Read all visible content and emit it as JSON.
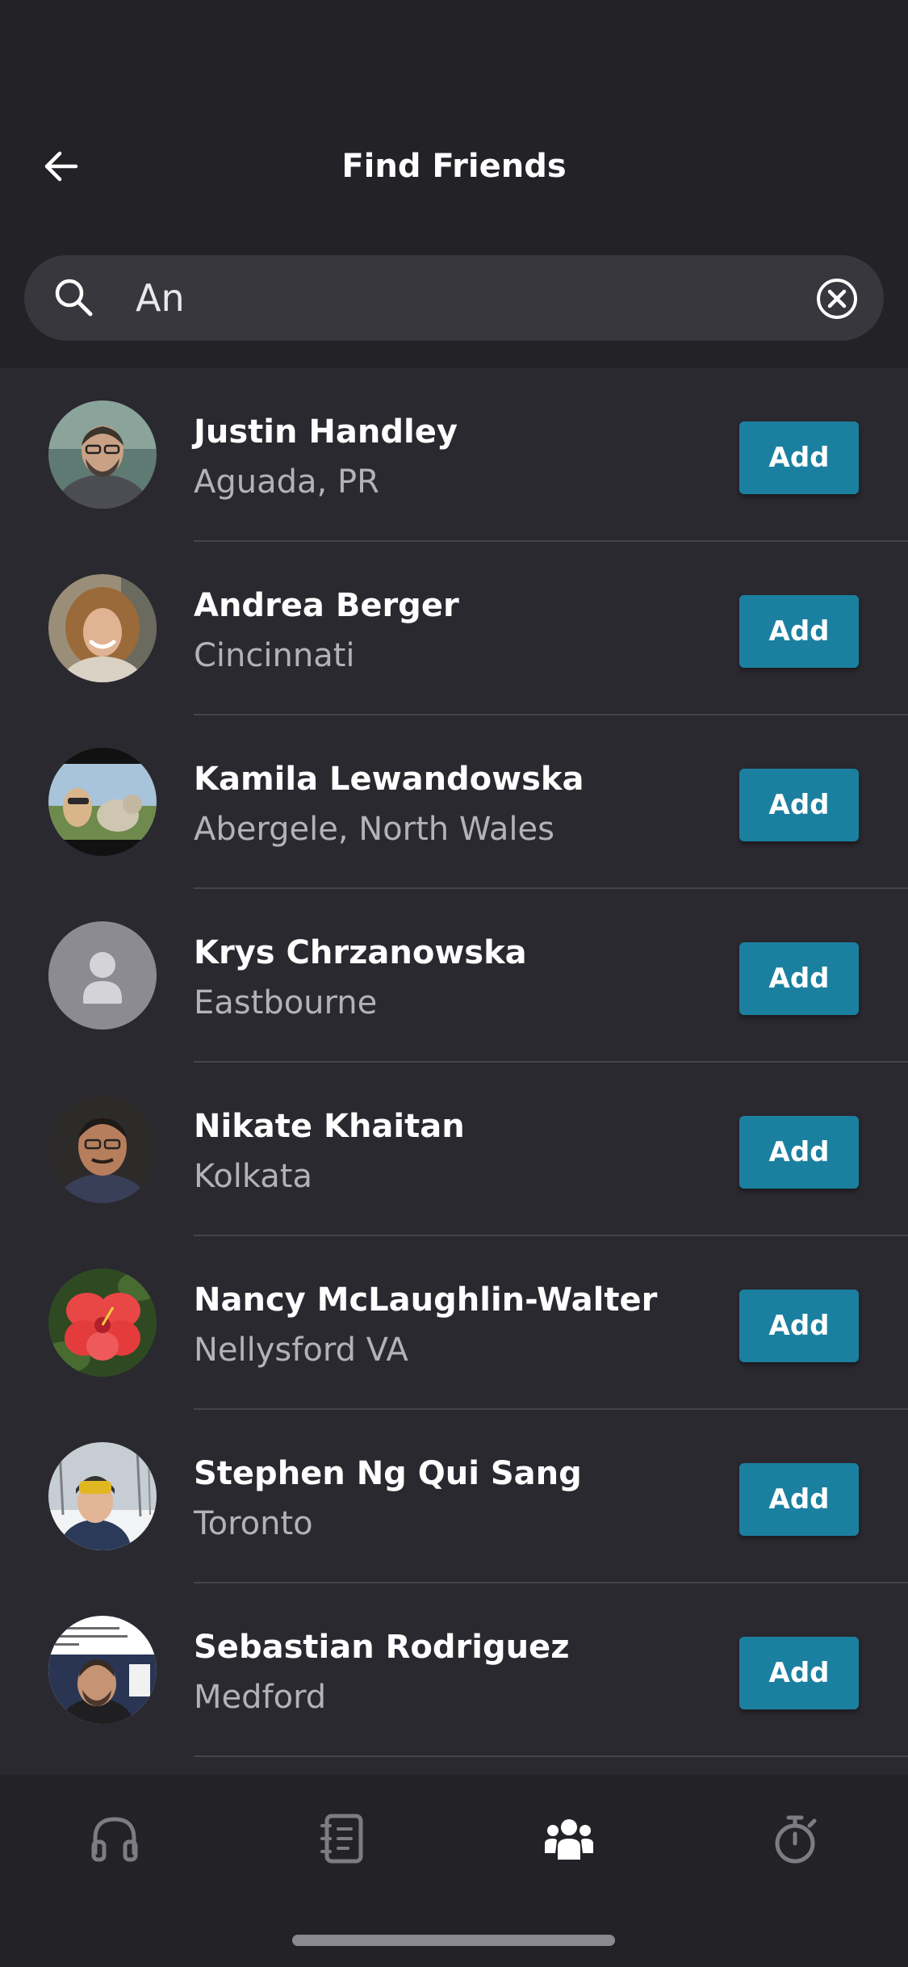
{
  "header": {
    "title": "Find Friends"
  },
  "search": {
    "value": "An"
  },
  "results": [
    {
      "name": "Justin Handley",
      "location": "Aguada, PR",
      "action": "Add"
    },
    {
      "name": "Andrea Berger",
      "location": "Cincinnati",
      "action": "Add"
    },
    {
      "name": "Kamila Lewandowska",
      "location": "Abergele, North Wales",
      "action": "Add"
    },
    {
      "name": "Krys Chrzanowska",
      "location": "Eastbourne",
      "action": "Add"
    },
    {
      "name": "Nikate Khaitan",
      "location": "Kolkata",
      "action": "Add"
    },
    {
      "name": "Nancy McLaughlin-Walter",
      "location": "Nellysford VA",
      "action": "Add"
    },
    {
      "name": "Stephen Ng Qui Sang",
      "location": "Toronto",
      "action": "Add"
    },
    {
      "name": "Sebastian Rodriguez",
      "location": "Medford",
      "action": "Add"
    }
  ],
  "tabs": [
    {
      "icon": "headphones-icon",
      "active": false
    },
    {
      "icon": "notebook-icon",
      "active": false
    },
    {
      "icon": "friends-icon",
      "active": true
    },
    {
      "icon": "stopwatch-icon",
      "active": false
    }
  ],
  "colors": {
    "background": "#2a292f",
    "header": "#232227",
    "accent": "#1b80a0"
  }
}
